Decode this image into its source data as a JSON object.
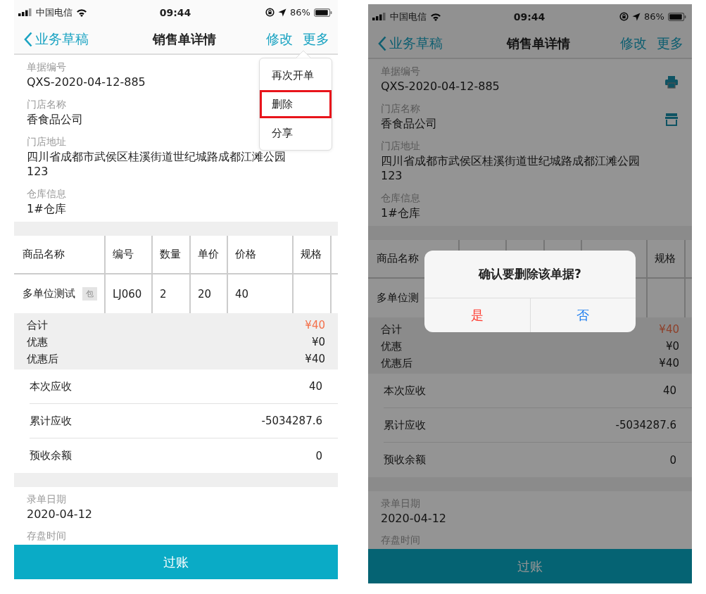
{
  "screens": [
    {
      "status_bar": {
        "carrier": "中国电信",
        "time": "09:44",
        "battery": "86%"
      },
      "nav": {
        "back": "业务草稿",
        "title": "销售单详情",
        "actions": [
          "修改",
          "更多"
        ]
      },
      "fields": [
        {
          "label": "单据编号",
          "value": "QXS-2020-04-12-885"
        },
        {
          "label": "门店名称",
          "value": "香食品公司"
        },
        {
          "label": "门店地址",
          "value": "四川省成都市武侯区桂溪街道世纪城路成都江滩公园123"
        },
        {
          "label": "仓库信息",
          "value": "1#仓库"
        }
      ],
      "table": {
        "columns": [
          "商品名称",
          "编号",
          "数量",
          "单价",
          "价格",
          "规格"
        ],
        "rows": [
          {
            "cells": [
              "多单位测试",
              "LJ060",
              "2",
              "20",
              "40",
              null
            ],
            "tag": "包"
          }
        ]
      },
      "summary": [
        {
          "label": "合计",
          "value": "¥40",
          "kind": "total"
        },
        {
          "label": "优惠",
          "value": "¥0",
          "kind": "plain"
        },
        {
          "label": "优惠后",
          "value": "¥40",
          "kind": "plain"
        }
      ],
      "receivables": [
        {
          "label": "本次应收",
          "value": "40"
        },
        {
          "label": "累计应收",
          "value": "-5034287.6"
        },
        {
          "label": "预收余额",
          "value": "0"
        }
      ],
      "footer_fields": [
        {
          "label": "录单日期",
          "value": "2020-04-12"
        },
        {
          "label": "存盘时间"
        }
      ],
      "primary_button": "过账",
      "menu": {
        "items": [
          {
            "label": "再次开单",
            "highlighted": false
          },
          {
            "label": "删除",
            "highlighted": true
          },
          {
            "label": "分享",
            "highlighted": false
          }
        ]
      }
    },
    {
      "status_bar": {
        "carrier": "中国电信",
        "time": "09:44",
        "battery": "86%"
      },
      "nav": {
        "back": "业务草稿",
        "title": "销售单详情",
        "actions": [
          "修改",
          "更多"
        ]
      },
      "fields": [
        {
          "label": "单据编号",
          "value": "QXS-2020-04-12-885"
        },
        {
          "label": "门店名称",
          "value": "香食品公司"
        },
        {
          "label": "门店地址",
          "value": "四川省成都市武侯区桂溪街道世纪城路成都江滩公园123"
        },
        {
          "label": "仓库信息",
          "value": "1#仓库"
        }
      ],
      "table": {
        "columns": [
          "商品名称",
          null,
          null,
          null,
          null,
          "规格"
        ],
        "rows": [
          {
            "cells": [
              "多单位测",
              null,
              null,
              null,
              null,
              null
            ]
          }
        ]
      },
      "summary": [
        {
          "label": "合计",
          "value": "¥40",
          "kind": "total"
        },
        {
          "label": "优惠",
          "value": "¥0",
          "kind": "plain"
        },
        {
          "label": "优惠后",
          "value": "¥40",
          "kind": "plain"
        }
      ],
      "receivables": [
        {
          "label": "本次应收",
          "value": "40"
        },
        {
          "label": "累计应收",
          "value": "-5034287.6"
        },
        {
          "label": "预收余额",
          "value": "0"
        }
      ],
      "footer_fields": [
        {
          "label": "录单日期",
          "value": "2020-04-12"
        },
        {
          "label": "存盘时间"
        }
      ],
      "primary_button": "过账",
      "dialog": {
        "message": "确认要删除该单据?",
        "buttons": [
          {
            "label": "是",
            "kind": "destructive"
          },
          {
            "label": "否",
            "kind": "cancel"
          }
        ]
      }
    }
  ]
}
